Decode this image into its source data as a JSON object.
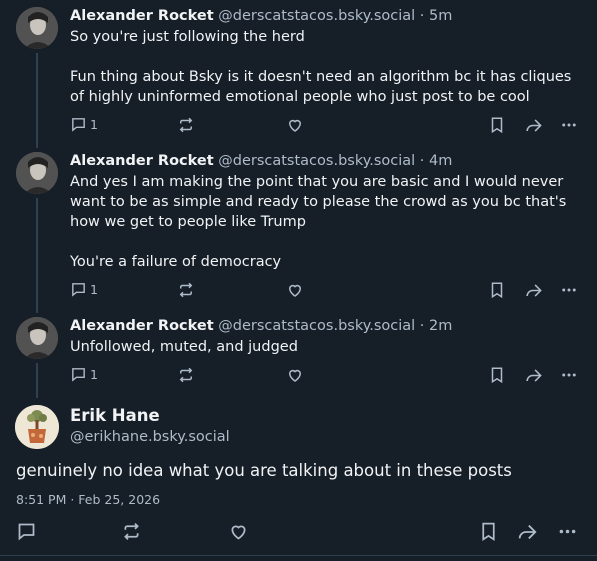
{
  "replies": [
    {
      "author_name": "Alexander Rocket",
      "author_handle": "@derscatstacos.bsky.social",
      "time": "5m",
      "paragraphs": [
        "So you're just following the herd",
        "Fun thing about Bsky is it doesn't need an algorithm bc it has cliques of highly uninformed emotional people who just post to be cool"
      ],
      "reply_count": "1"
    },
    {
      "author_name": "Alexander Rocket",
      "author_handle": "@derscatstacos.bsky.social",
      "time": "4m",
      "paragraphs": [
        "And yes I am making the point that you are basic and I would never want to be as simple and ready to please the crowd as you bc that's how we get to people like Trump",
        "You're a failure of democracy"
      ],
      "reply_count": "1"
    },
    {
      "author_name": "Alexander Rocket",
      "author_handle": "@derscatstacos.bsky.social",
      "time": "2m",
      "paragraphs": [
        "Unfollowed, muted, and judged"
      ],
      "reply_count": "1"
    }
  ],
  "main_post": {
    "author_name": "Erik Hane",
    "author_handle": "@erikhane.bsky.social",
    "text": "genuinely no idea what you are talking about in these posts",
    "timestamp": "8:51 PM · Feb 25, 2026"
  },
  "separator": " · ",
  "icons": [
    "reply-icon",
    "repost-icon",
    "like-icon",
    "bookmark-icon",
    "share-icon",
    "more-icon"
  ],
  "colors": {
    "background": "#161e27",
    "text": "#f1f3f5",
    "muted": "#aebbc9",
    "thread_line": "#2e4052"
  }
}
